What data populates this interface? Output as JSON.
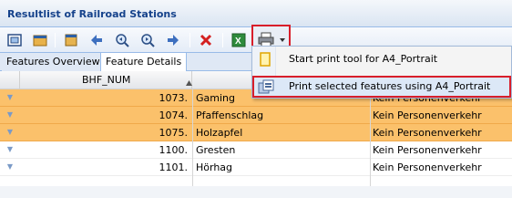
{
  "window": {
    "title": "Resultlist of Railroad Stations"
  },
  "toolbar": {
    "buttons": [
      {
        "name": "zoom-to-extent-icon"
      },
      {
        "name": "folder-icon"
      },
      {
        "name": "layer-icon"
      },
      {
        "name": "back-arrow-icon"
      },
      {
        "name": "zoom-in-icon"
      },
      {
        "name": "zoom-out-icon"
      },
      {
        "name": "forward-arrow-icon"
      },
      {
        "name": "clear-icon"
      },
      {
        "name": "excel-export-icon"
      },
      {
        "name": "print-icon"
      }
    ],
    "colors": {
      "accent": "#15428b",
      "highlight_border": "#d81e2a"
    }
  },
  "tabs": [
    {
      "label": "Features Overview",
      "active": false
    },
    {
      "label": "Feature Details",
      "active": true
    }
  ],
  "grid": {
    "columns": [
      {
        "label": "BHF_NUM",
        "sort": "ascending"
      },
      {
        "label": ""
      },
      {
        "label": ""
      }
    ],
    "rows": [
      {
        "num": "1073.",
        "name": "Gaming",
        "desc": "Kein Personenverkehr",
        "selected": true
      },
      {
        "num": "1074.",
        "name": "Pfaffenschlag",
        "desc": "Kein Personenverkehr",
        "selected": true
      },
      {
        "num": "1075.",
        "name": "Holzapfel",
        "desc": "Kein Personenverkehr",
        "selected": true
      },
      {
        "num": "1100.",
        "name": "Gresten",
        "desc": "Kein Personenverkehr",
        "selected": false
      },
      {
        "num": "1101.",
        "name": "Hörhag",
        "desc": "Kein Personenverkehr",
        "selected": false
      }
    ],
    "selection_color": "#fbc16b"
  },
  "print_menu": {
    "items": [
      {
        "label": "Start print tool for A4_Portrait",
        "icon": "print-tool-icon"
      },
      {
        "label": "Print selected features using A4_Portrait",
        "icon": "print-selected-icon"
      }
    ]
  }
}
